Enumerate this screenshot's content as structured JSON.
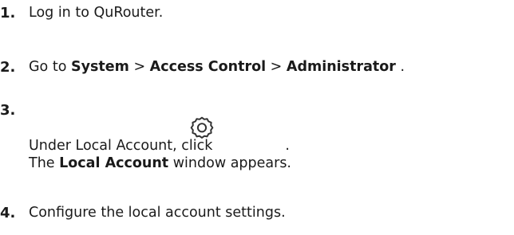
{
  "steps": [
    {
      "number": "1.",
      "text": "Log in to QuRouter."
    },
    {
      "number": "2.",
      "prefix": "Go to ",
      "path": [
        "System",
        "Access Control",
        "Administrator"
      ],
      "separator": " > ",
      "suffix": " ."
    },
    {
      "number": "3.",
      "line1_prefix": "Under Local Account, click",
      "line1_suffix": ".",
      "icon": "gear-icon",
      "line2_prefix": "The ",
      "line2_bold": "Local Account",
      "line2_suffix": " window appears."
    },
    {
      "number": "4.",
      "text": "Configure the local account settings."
    }
  ]
}
